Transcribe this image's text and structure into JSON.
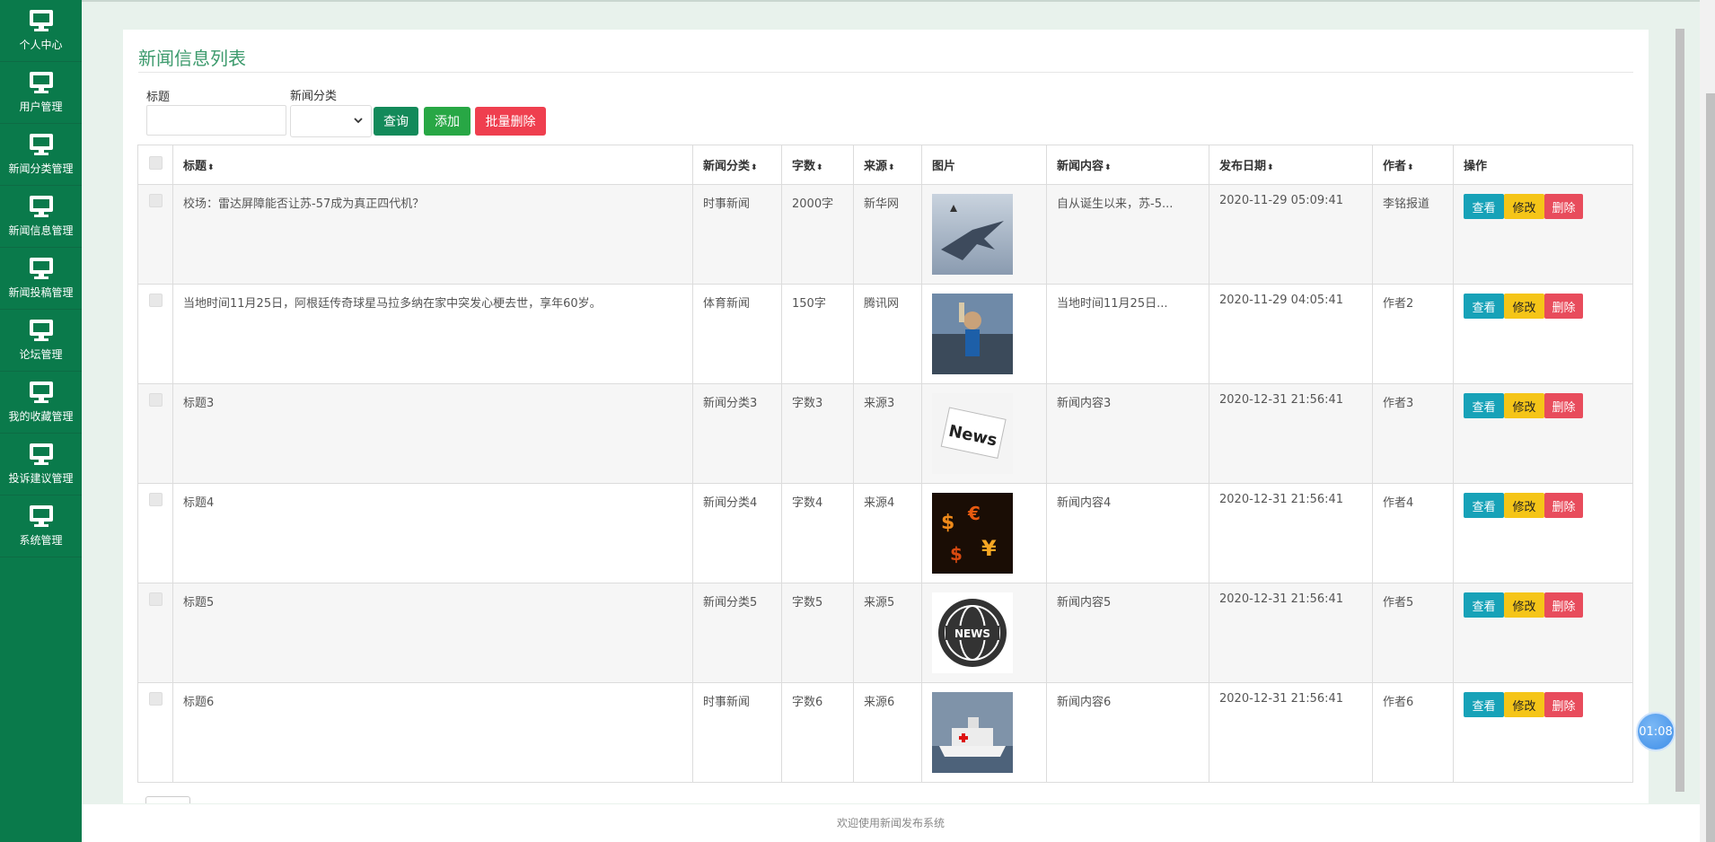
{
  "sidebar": {
    "items": [
      {
        "label": "个人中心",
        "icon": "monitor-icon"
      },
      {
        "label": "用户管理",
        "icon": "monitor-icon"
      },
      {
        "label": "新闻分类管理",
        "icon": "monitor-icon"
      },
      {
        "label": "新闻信息管理",
        "icon": "monitor-icon"
      },
      {
        "label": "新闻投稿管理",
        "icon": "monitor-icon"
      },
      {
        "label": "论坛管理",
        "icon": "monitor-icon"
      },
      {
        "label": "我的收藏管理",
        "icon": "monitor-icon"
      },
      {
        "label": "投诉建议管理",
        "icon": "monitor-icon"
      },
      {
        "label": "系统管理",
        "icon": "monitor-icon"
      }
    ]
  },
  "page": {
    "title": "新闻信息列表"
  },
  "search": {
    "title_label": "标题",
    "title_value": "",
    "category_label": "新闻分类",
    "category_value": "",
    "query_button": "查询",
    "add_button": "添加",
    "batch_delete_button": "批量删除"
  },
  "table": {
    "headers": {
      "title": "标题",
      "category": "新闻分类",
      "words": "字数",
      "source": "来源",
      "image": "图片",
      "content": "新闻内容",
      "date": "发布日期",
      "author": "作者",
      "ops": "操作"
    },
    "sort_glyph": "⬍",
    "rows": [
      {
        "title": "校场：雷达屏障能否让苏-57成为真正四代机？",
        "category": "时事新闻",
        "words": "2000字",
        "source": "新华网",
        "image": "fighter-jet",
        "content": "自从诞生以来，苏-5...",
        "date": "2020-11-29 05:09:41",
        "author": "李铭报道"
      },
      {
        "title": "当地时间11月25日，阿根廷传奇球星马拉多纳在家中突发心梗去世，享年60岁。",
        "category": "体育新闻",
        "words": "150字",
        "source": "腾讯网",
        "image": "stadium-crowd",
        "content": "当地时间11月25日...",
        "date": "2020-11-29 04:05:41",
        "author": "作者2"
      },
      {
        "title": "标题3",
        "category": "新闻分类3",
        "words": "字数3",
        "source": "来源3",
        "image": "news-paper",
        "content": "新闻内容3",
        "date": "2020-12-31 21:56:41",
        "author": "作者3"
      },
      {
        "title": "标题4",
        "category": "新闻分类4",
        "words": "字数4",
        "source": "来源4",
        "image": "currency-fire",
        "content": "新闻内容4",
        "date": "2020-12-31 21:56:41",
        "author": "作者4"
      },
      {
        "title": "标题5",
        "category": "新闻分类5",
        "words": "字数5",
        "source": "来源5",
        "image": "news-globe",
        "content": "新闻内容5",
        "date": "2020-12-31 21:56:41",
        "author": "作者5"
      },
      {
        "title": "标题6",
        "category": "时事新闻",
        "words": "字数6",
        "source": "来源6",
        "image": "hospital-ship",
        "content": "新闻内容6",
        "date": "2020-12-31 21:56:41",
        "author": "作者6"
      }
    ],
    "row_actions": {
      "view": "查看",
      "edit": "修改",
      "delete": "删除"
    }
  },
  "footer": {
    "text": "欢迎使用新闻发布系统"
  },
  "timer": {
    "text": "01:08"
  },
  "colors": {
    "sidebar": "#0a7a4b",
    "title": "#3c9a6c",
    "query": "#138a5a",
    "add": "#28a745",
    "batch_delete": "#ef3f4f",
    "view": "#17a2b8",
    "edit": "#f5c518",
    "delete": "#e84c5c"
  }
}
